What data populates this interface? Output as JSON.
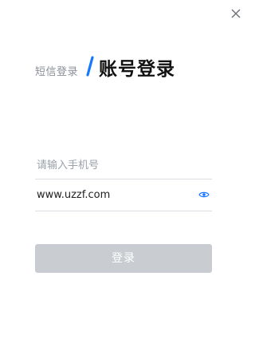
{
  "tabs": {
    "sms_login": "短信登录",
    "account_login": "账号登录"
  },
  "form": {
    "phone_placeholder": "请输入手机号",
    "phone_value": "",
    "password_value": "www.uzzf.com"
  },
  "login_button": {
    "label": "登录"
  },
  "icons": {
    "close": "close-icon",
    "eye": "eye-icon"
  },
  "colors": {
    "accent": "#1677ff",
    "button_disabled_bg": "#c9ccd1",
    "muted_text": "#8a8f99",
    "divider": "#dcdfe4"
  }
}
